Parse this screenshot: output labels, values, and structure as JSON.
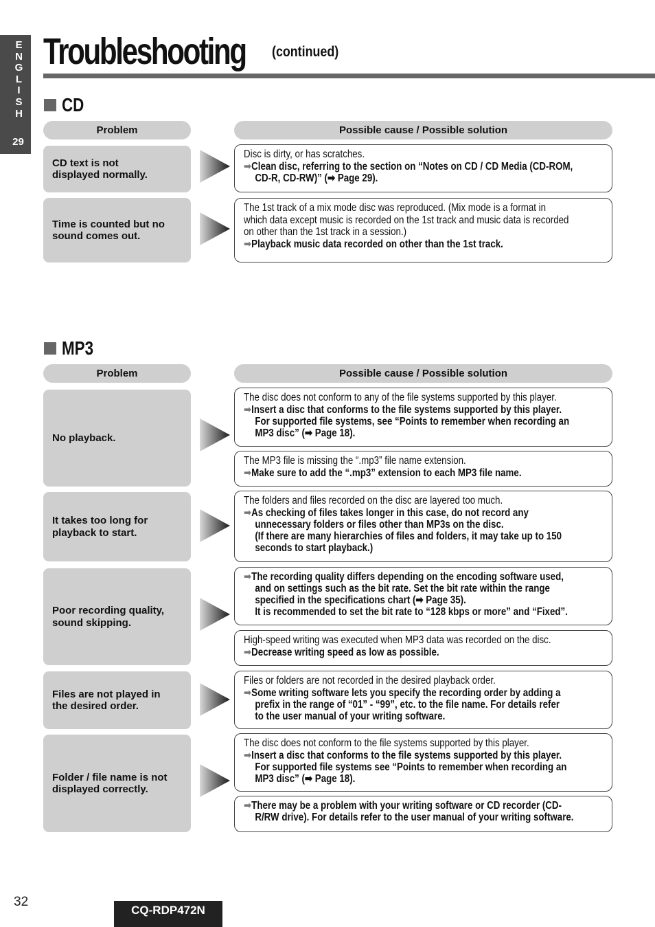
{
  "side_tab": {
    "letters": [
      "E",
      "N",
      "G",
      "L",
      "I",
      "S",
      "H"
    ],
    "section_number": "29"
  },
  "header": {
    "title": "Troubleshooting",
    "subtitle": "(continued)"
  },
  "icons": {
    "section_marker": "square-bullet-icon",
    "arrow": "triangle-arrow-icon",
    "inline_arrow": "➡"
  },
  "columns": {
    "problem": "Problem",
    "solution": "Possible cause / Possible solution"
  },
  "sections": [
    {
      "label": "CD",
      "rows": [
        {
          "problem": [
            "CD text is not",
            "displayed normally."
          ],
          "solutions": [
            {
              "cause": [
                "Disc is dirty, or has scratches."
              ],
              "fix": [
                "Clean disc, referring to the section on “Notes on CD / CD Media (CD-ROM,",
                "CD-R, CD-RW)” (➡ Page 29)."
              ]
            }
          ]
        },
        {
          "problem": [
            "Time is counted but no",
            "sound comes out."
          ],
          "solutions": [
            {
              "cause": [
                "The 1st track of a mix mode disc was reproduced. (Mix mode is a format in",
                "which data except music is recorded on the 1st track and music data is recorded",
                "on other than the 1st track in a session.)"
              ],
              "fix": [
                "Playback music data recorded on other than the 1st track."
              ]
            }
          ]
        }
      ]
    },
    {
      "label": "MP3",
      "rows": [
        {
          "problem": [
            "No playback."
          ],
          "solutions": [
            {
              "cause": [
                "The disc does not conform to any of the file systems supported by this player."
              ],
              "fix": [
                "Insert a disc that conforms to the file systems supported by this player.",
                "For supported file systems, see “Points to remember when recording an",
                "MP3 disc” (➡ Page 18)."
              ]
            },
            {
              "cause": [
                "The MP3 file is missing the “.mp3” file name extension."
              ],
              "fix": [
                "Make sure to add the “.mp3” extension to each MP3 file name."
              ]
            }
          ]
        },
        {
          "problem": [
            "It takes too long for",
            "playback to start."
          ],
          "solutions": [
            {
              "cause": [
                "The folders and files recorded on the disc are layered too much."
              ],
              "fix": [
                "As checking of files takes longer in this case, do not record any",
                "unnecessary folders or files other than MP3s on the disc.",
                "(If there are many hierarchies of files and folders, it may take up to 150",
                "seconds to start playback.)"
              ]
            }
          ]
        },
        {
          "problem": [
            "Poor recording quality,",
            "sound skipping."
          ],
          "solutions": [
            {
              "cause": [],
              "fix": [
                "The recording quality differs depending on the encoding software used,",
                "and on settings such as the bit rate.  Set the bit rate within the range",
                "specified in the specifications chart (➡ Page 35).",
                "It is recommended to set the bit rate to “128 kbps or more” and “Fixed”."
              ]
            },
            {
              "cause": [
                "High-speed writing was executed when MP3 data was recorded on the disc."
              ],
              "fix": [
                "Decrease writing speed as low as possible."
              ]
            }
          ]
        },
        {
          "problem": [
            "Files are not played in",
            "the desired order."
          ],
          "solutions": [
            {
              "cause": [
                "Files or folders are not recorded in the desired playback order."
              ],
              "fix": [
                "Some writing software lets you specify the recording order by adding a",
                "prefix in the range of “01” - “99”, etc. to the file name.  For details refer",
                "to the user manual of your writing software."
              ]
            }
          ]
        },
        {
          "problem": [
            "Folder / file name is not",
            "displayed correctly."
          ],
          "solutions": [
            {
              "cause": [
                "The disc does not conform to the file systems supported by this player."
              ],
              "fix": [
                "Insert a disc that conforms to the file systems supported by this player.",
                "For supported file systems see “Points to remember when recording an",
                "MP3 disc” (➡ Page 18)."
              ]
            },
            {
              "cause": [],
              "fix": [
                "There may be a problem with your writing software or CD recorder (CD-",
                "R/RW drive).  For details refer to the user manual of your writing software."
              ]
            }
          ]
        }
      ]
    }
  ],
  "footer": {
    "page_number": "32",
    "model": "CQ-RDP472N"
  },
  "colors": {
    "tab_bg": "#4a4a4a",
    "rule": "#666666",
    "box_gray": "#cfcfcf",
    "border": "#444444"
  }
}
